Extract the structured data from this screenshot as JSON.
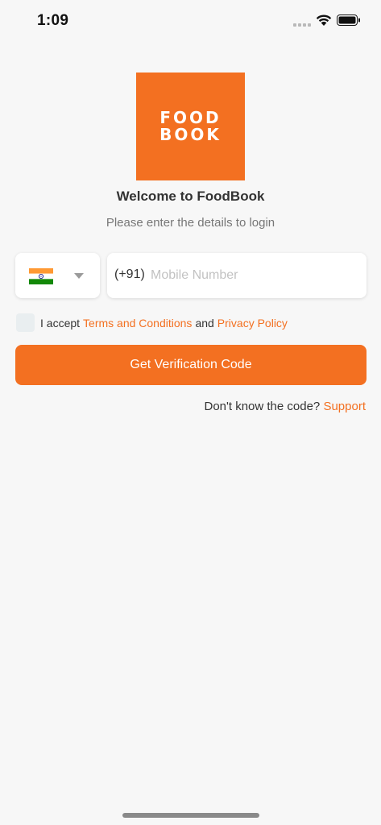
{
  "status_bar": {
    "time": "1:09",
    "icons": [
      "signal-icon",
      "wifi-icon",
      "battery-icon"
    ]
  },
  "logo": {
    "line1": "FOOD",
    "line2": "BOOK",
    "color": "#f37021"
  },
  "header": {
    "title": "Welcome to FoodBook",
    "subtitle": "Please enter the details to login"
  },
  "country_select": {
    "flag": "🇮🇳",
    "icon": "chevron-down-icon"
  },
  "phone": {
    "dial_code": "(+91)",
    "value": "",
    "placeholder": "Mobile Number"
  },
  "terms": {
    "prefix": "I accept",
    "terms_link": "Terms and Conditions",
    "conjunction": "and",
    "privacy_link": "Privacy Policy",
    "checked": false
  },
  "cta": {
    "label": "Get Verification Code"
  },
  "support": {
    "prompt": "Don't know the code?",
    "link": "Support"
  },
  "colors": {
    "accent": "#f37021",
    "background": "#f7f7f7",
    "text": "#333333",
    "muted": "#777777"
  }
}
